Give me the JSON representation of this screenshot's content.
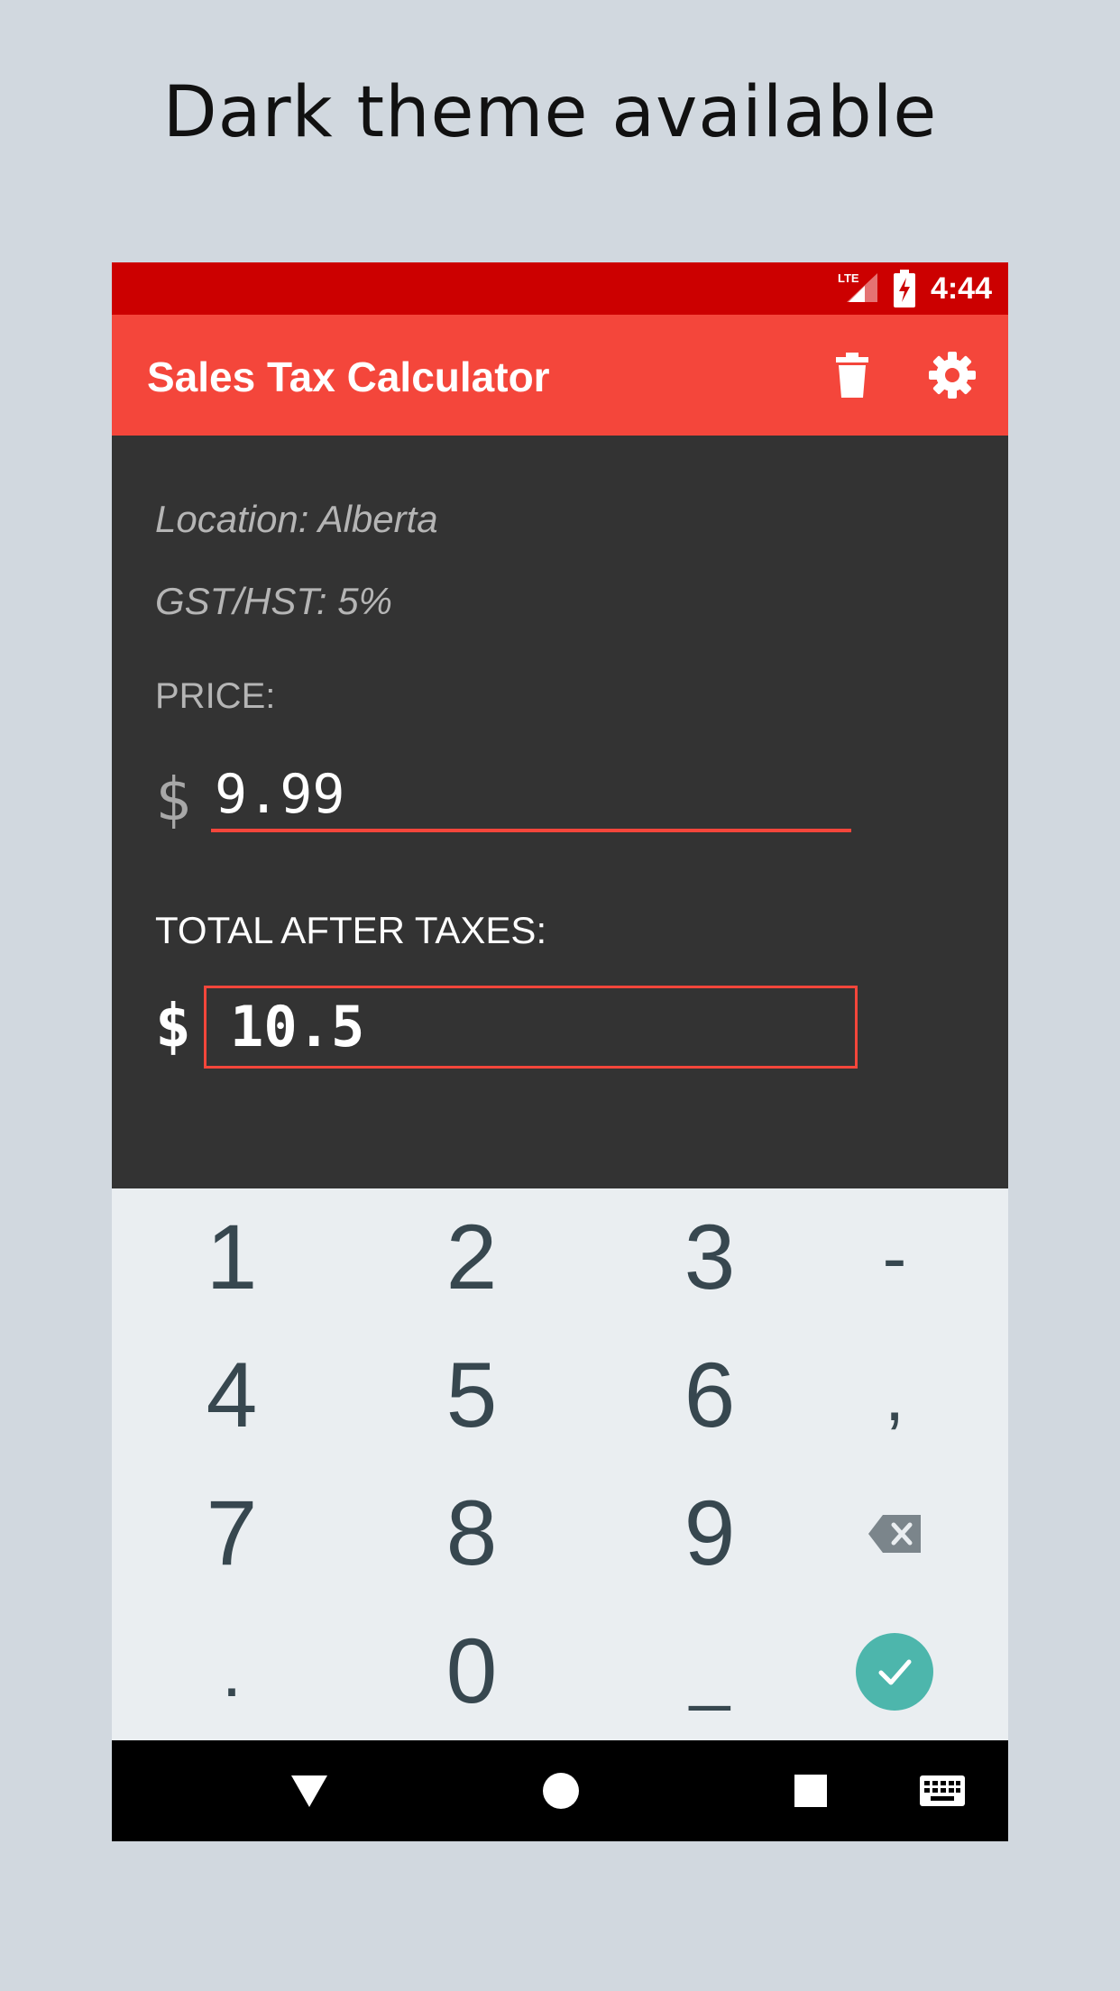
{
  "headline": "Dark theme available",
  "status_bar": {
    "time": "4:44",
    "network_label": "LTE",
    "icons": [
      "lte-signal-icon",
      "battery-charging-icon"
    ],
    "background": "#cc0000"
  },
  "app_bar": {
    "title": "Sales Tax Calculator",
    "background": "#f4463b",
    "actions": [
      "trash-icon",
      "gear-icon"
    ]
  },
  "calculator": {
    "location_text": "Location: Alberta",
    "gst_text": "GST/HST: 5%",
    "price_label": "PRICE:",
    "currency_symbol": "$",
    "price_value": "9.99",
    "total_label": "TOTAL AFTER TAXES:",
    "total_value": "10.5",
    "accent": "#f4463b",
    "background": "#333333"
  },
  "keyboard": {
    "rows": [
      [
        "1",
        "2",
        "3",
        "-"
      ],
      [
        "4",
        "5",
        "6",
        ","
      ],
      [
        "7",
        "8",
        "9",
        "backspace-icon"
      ],
      [
        ".",
        "0",
        "_",
        "check-icon"
      ]
    ],
    "check_color": "#4db6ac",
    "background": "#eaeef1"
  },
  "nav_bar": {
    "icons": [
      "back-triangle-icon",
      "home-circle-icon",
      "recents-square-icon",
      "keyboard-icon"
    ]
  }
}
